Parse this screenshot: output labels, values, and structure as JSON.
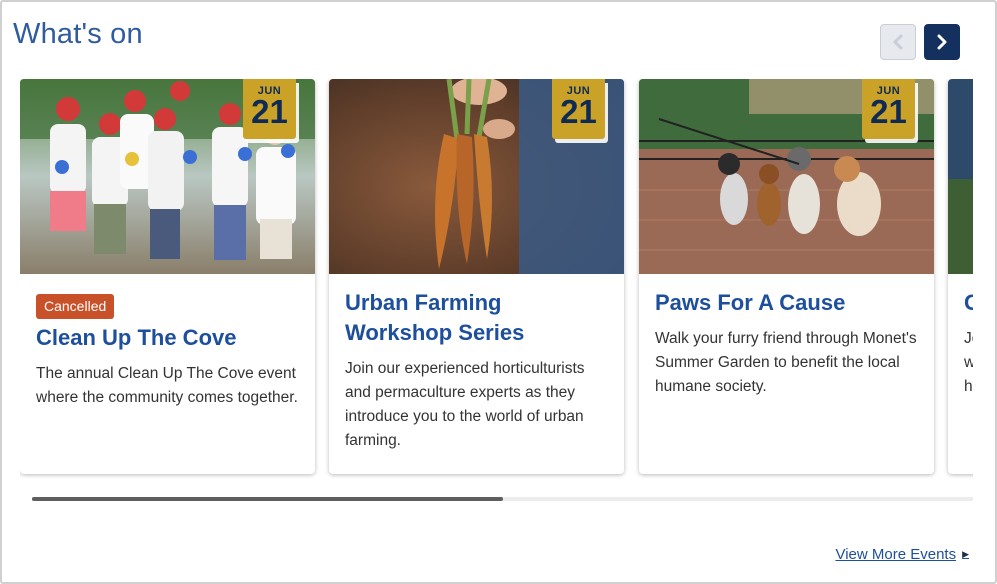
{
  "section": {
    "title": "What's on",
    "view_more": "View More Events"
  },
  "nav": {
    "prev_icon": "chevron-left-icon",
    "next_icon": "chevron-right-icon"
  },
  "colors": {
    "accent_blue": "#1d4f9c",
    "nav_dark": "#14305f",
    "date_gold": "#c9a227",
    "cancelled": "#c9512a"
  },
  "events": [
    {
      "month": "JUN",
      "day": "21",
      "status": "Cancelled",
      "title": "Clean Up The Cove",
      "description": "The annual Clean Up The Cove event where the community comes together.",
      "image": "volunteers-photo"
    },
    {
      "month": "JUN",
      "day": "21",
      "title": "Urban Farming Workshop Series",
      "description": "Join our experienced horticulturists and permaculture experts as they introduce you to the world of urban farming.",
      "image": "carrots-photo"
    },
    {
      "month": "JUN",
      "day": "21",
      "title": "Paws For A Cause",
      "description": "Walk your furry friend through Monet's Summer Garden to benefit the local humane society.",
      "image": "dogs-photo"
    },
    {
      "title": "G",
      "description_fragments": [
        "Jo",
        "w",
        "h"
      ],
      "image": "partial-photo"
    }
  ],
  "carousel_progress": 0.5
}
